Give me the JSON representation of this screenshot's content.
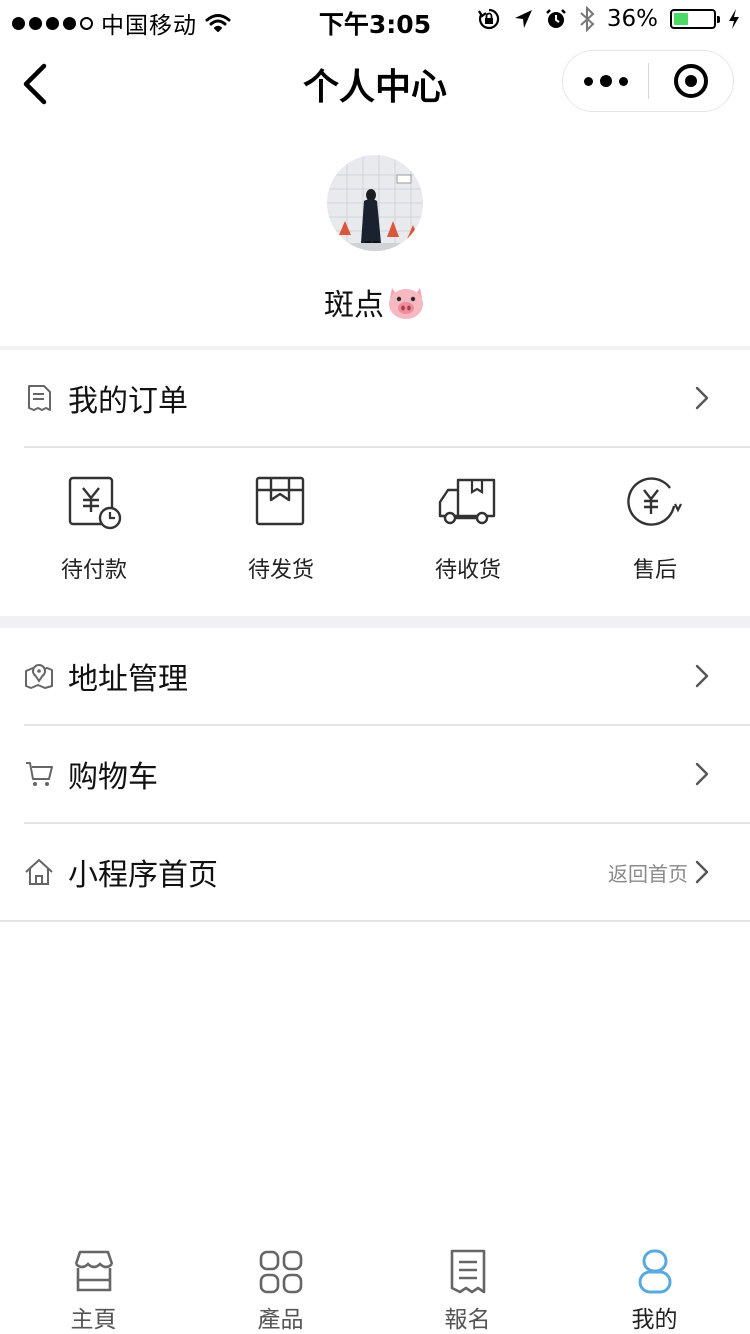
{
  "status_bar": {
    "carrier": "中国移动",
    "time": "下午3:05",
    "battery_percent": "36%",
    "battery_level": 0.36,
    "signal_bars_filled": 4,
    "signal_bars_total": 5,
    "icons": [
      "wifi-icon",
      "rotation-lock-icon",
      "location-icon",
      "alarm-icon",
      "bluetooth-icon",
      "charging-icon"
    ]
  },
  "nav": {
    "title": "个人中心",
    "back_icon": "chevron-left-icon",
    "more_icon": "more-dots-icon",
    "close_icon": "target-close-icon"
  },
  "profile": {
    "nickname": "斑点",
    "nickname_emoji": "pig-face-icon"
  },
  "orders": {
    "label": "我的订单",
    "icon": "receipt-icon",
    "items": [
      {
        "label": "待付款",
        "icon": "yen-clock-icon"
      },
      {
        "label": "待发货",
        "icon": "package-icon"
      },
      {
        "label": "待收货",
        "icon": "truck-icon"
      },
      {
        "label": "售后",
        "icon": "yen-refund-icon"
      }
    ]
  },
  "menu": [
    {
      "label": "地址管理",
      "icon": "map-pin-icon",
      "sub": ""
    },
    {
      "label": "购物车",
      "icon": "cart-icon",
      "sub": ""
    },
    {
      "label": "小程序首页",
      "icon": "home-icon",
      "sub": "返回首页"
    }
  ],
  "tab_bar": {
    "items": [
      {
        "label": "主頁",
        "icon": "store-icon",
        "active": false
      },
      {
        "label": "產品",
        "icon": "grid-icon",
        "active": false
      },
      {
        "label": "報名",
        "icon": "document-icon",
        "active": false
      },
      {
        "label": "我的",
        "icon": "person-icon",
        "active": true
      }
    ],
    "active_color": "#5aa9de"
  },
  "colors": {
    "section_bg": "#f1f1f3",
    "separator": "#e5e5e5",
    "battery_green": "#4cd964"
  }
}
